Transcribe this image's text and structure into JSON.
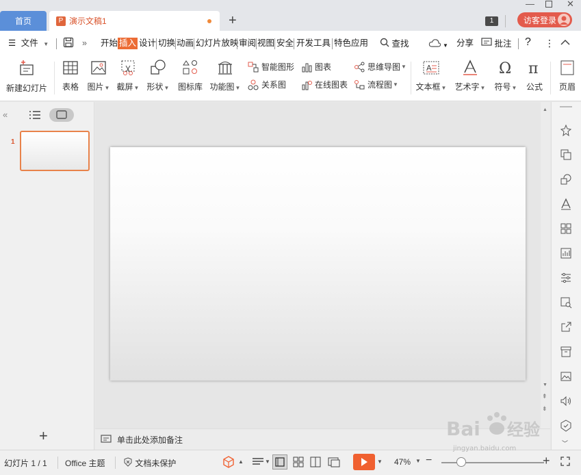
{
  "titlebar": {
    "home_tab": "首页",
    "doc_tab": "演示文稿1",
    "ppt_badge": "P",
    "new_tab": "+",
    "badge_count": "1",
    "login": "访客登录"
  },
  "menubar": {
    "file": "文件",
    "tabs": [
      "开始",
      "插入",
      "设计",
      "切换",
      "动画",
      "幻灯片放映",
      "审阅",
      "视图",
      "安全",
      "开发工具",
      "特色应用"
    ],
    "active_tab": "插入",
    "search": "查找",
    "share": "分享",
    "comment": "批注",
    "help": "?"
  },
  "ribbon": {
    "new_slide": "新建幻灯片",
    "table": "表格",
    "picture": "图片",
    "screenshot": "截屏",
    "shape": "形状",
    "icon_lib": "图标库",
    "func_chart": "功能图",
    "smart_graphic": "智能图形",
    "chart": "图表",
    "relation": "关系图",
    "online_chart": "在线图表",
    "mindmap": "思维导图",
    "flowchart": "流程图",
    "textbox": "文本框",
    "wordart": "艺术字",
    "symbol": "符号",
    "formula": "公式",
    "header": "页眉"
  },
  "leftpanel": {
    "slide_number": "1",
    "add": "+"
  },
  "notes": {
    "placeholder": "单击此处添加备注"
  },
  "statusbar": {
    "slide_info": "幻灯片 1 / 1",
    "theme": "Office 主题",
    "protection": "文档未保护",
    "zoom": "47%",
    "zoom_level": 0.47
  },
  "colors": {
    "accent": "#ec6c35",
    "home_tab": "#5b8fd9",
    "login": "#e35b4c",
    "play": "#f06030"
  }
}
